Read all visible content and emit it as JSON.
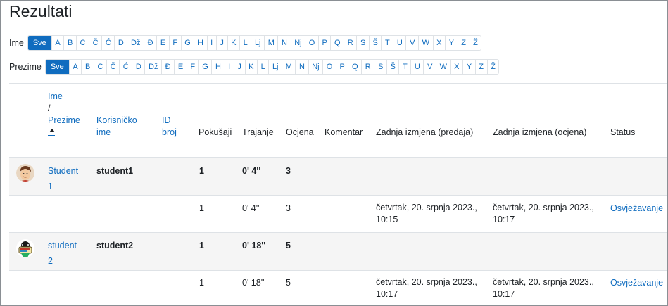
{
  "page": {
    "title": "Rezultati"
  },
  "firstname_filter": {
    "label": "Ime",
    "letters": [
      "Sve",
      "A",
      "B",
      "C",
      "Č",
      "Ć",
      "D",
      "Dž",
      "Đ",
      "E",
      "F",
      "G",
      "H",
      "I",
      "J",
      "K",
      "L",
      "Lj",
      "M",
      "N",
      "Nj",
      "O",
      "P",
      "Q",
      "R",
      "S",
      "Š",
      "T",
      "U",
      "V",
      "W",
      "X",
      "Y",
      "Z",
      "Ž"
    ]
  },
  "lastname_filter": {
    "label": "Prezime",
    "letters": [
      "Sve",
      "A",
      "B",
      "C",
      "Č",
      "Ć",
      "D",
      "Dž",
      "Đ",
      "E",
      "F",
      "G",
      "H",
      "I",
      "J",
      "K",
      "L",
      "Lj",
      "M",
      "N",
      "Nj",
      "O",
      "P",
      "Q",
      "R",
      "S",
      "Š",
      "T",
      "U",
      "V",
      "W",
      "X",
      "Y",
      "Z",
      "Ž"
    ]
  },
  "columns": {
    "firstname": "Ime",
    "slash": "/",
    "lastname": "Prezime",
    "username_1": "Korisničko",
    "username_2": "ime",
    "idnumber_1": "ID",
    "idnumber_2": "broj",
    "attempts": "Pokušaji",
    "duration": "Trajanje",
    "grade": "Ocjena",
    "comment": "Komentar",
    "modified_submission": "Zadnja izmjena (predaja)",
    "modified_grade": "Zadnja izmjena (ocjena)",
    "status": "Status"
  },
  "students": [
    {
      "name_1": "Student",
      "name_2": "1",
      "username": "student1",
      "attempts": "1",
      "duration": "0' 4''",
      "grade": "3",
      "attempt": {
        "attempts": "1",
        "duration": "0' 4''",
        "grade": "3",
        "submitted_1": "četvrtak, 20. srpnja 2023.,",
        "submitted_2": "10:15",
        "graded_1": "četvrtak, 20. srpnja 2023.,",
        "graded_2": "10:17",
        "status": "Osvježavanje"
      }
    },
    {
      "name_1": "student",
      "name_2": "2",
      "username": "student2",
      "attempts": "1",
      "duration": "0' 18''",
      "grade": "5",
      "attempt": {
        "attempts": "1",
        "duration": "0' 18''",
        "grade": "5",
        "submitted_1": "četvrtak, 20. srpnja 2023.,",
        "submitted_2": "10:17",
        "graded_1": "četvrtak, 20. srpnja 2023.,",
        "graded_2": "10:17",
        "status": "Osvježavanje"
      }
    }
  ],
  "colors": {
    "link": "#0f6cbf",
    "active_bg": "#0f6cbf",
    "row_shade": "#f5f5f5",
    "border": "#dee2e6"
  }
}
